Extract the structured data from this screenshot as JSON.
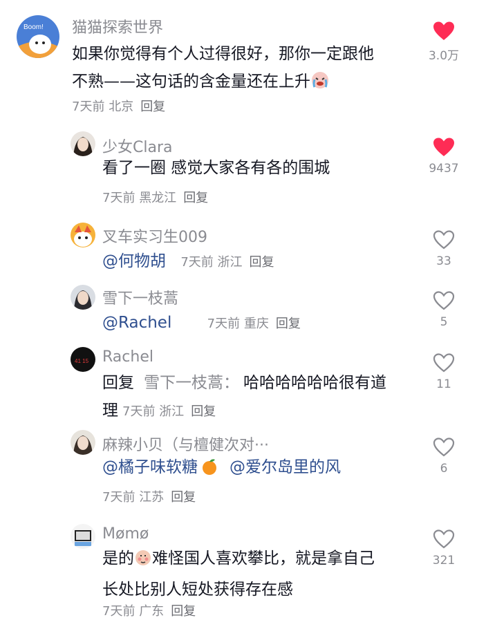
{
  "colors": {
    "liked": "#fe2c55",
    "mention": "#2f4f8f",
    "meta": "#8a8b91"
  },
  "comments": [
    {
      "username": "猫猫探索世界",
      "avatar_text": "Boom!",
      "line1": "如果你觉得有个人过得很好，那你一定跟他",
      "line2": "不熟——这句话的含金量还在上升",
      "emoji": "crying-face",
      "time": "7天前",
      "location": "北京",
      "reply": "回复",
      "likes": "3.0万",
      "liked": true
    },
    {
      "username": "少女Clara",
      "line1": "看了一圈 感觉大家各有各的围城",
      "time": "7天前",
      "location": "黑龙江",
      "reply": "回复",
      "likes": "9437",
      "liked": true
    },
    {
      "username": "叉车实习生009",
      "mention": "@何物胡",
      "time": "7天前",
      "location": "浙江",
      "reply": "回复",
      "likes": "33",
      "liked": false
    },
    {
      "username": "雪下一枝蒿",
      "mention": "@Rachel",
      "time": "7天前",
      "location": "重庆",
      "reply": "回复",
      "likes": "5",
      "liked": false
    },
    {
      "username": "Rachel",
      "avatar_text": "41 15",
      "reply_prefix": "回复",
      "reply_to": "雪下一枝蒿：",
      "line1_rest": "哈哈哈哈哈哈很有道",
      "line2": "理",
      "time": "7天前",
      "location": "浙江",
      "reply": "回复",
      "likes": "11",
      "liked": false
    },
    {
      "username": "麻辣小贝（与檀健次对···",
      "mention": "@橘子味软糖",
      "mention2": "@爱尔岛里的风",
      "emoji": "tangerine",
      "time": "7天前",
      "location": "江苏",
      "reply": "回复",
      "likes": "6",
      "liked": false
    },
    {
      "username": "Mømø",
      "line1_pre": "是的",
      "line1_post": "难怪国人喜欢攀比，就是拿自己",
      "line2": "长处比别人短处获得存在感",
      "emoji": "shy-face",
      "time": "7天前",
      "location": "广东",
      "reply": "回复",
      "likes": "321",
      "liked": false
    }
  ]
}
